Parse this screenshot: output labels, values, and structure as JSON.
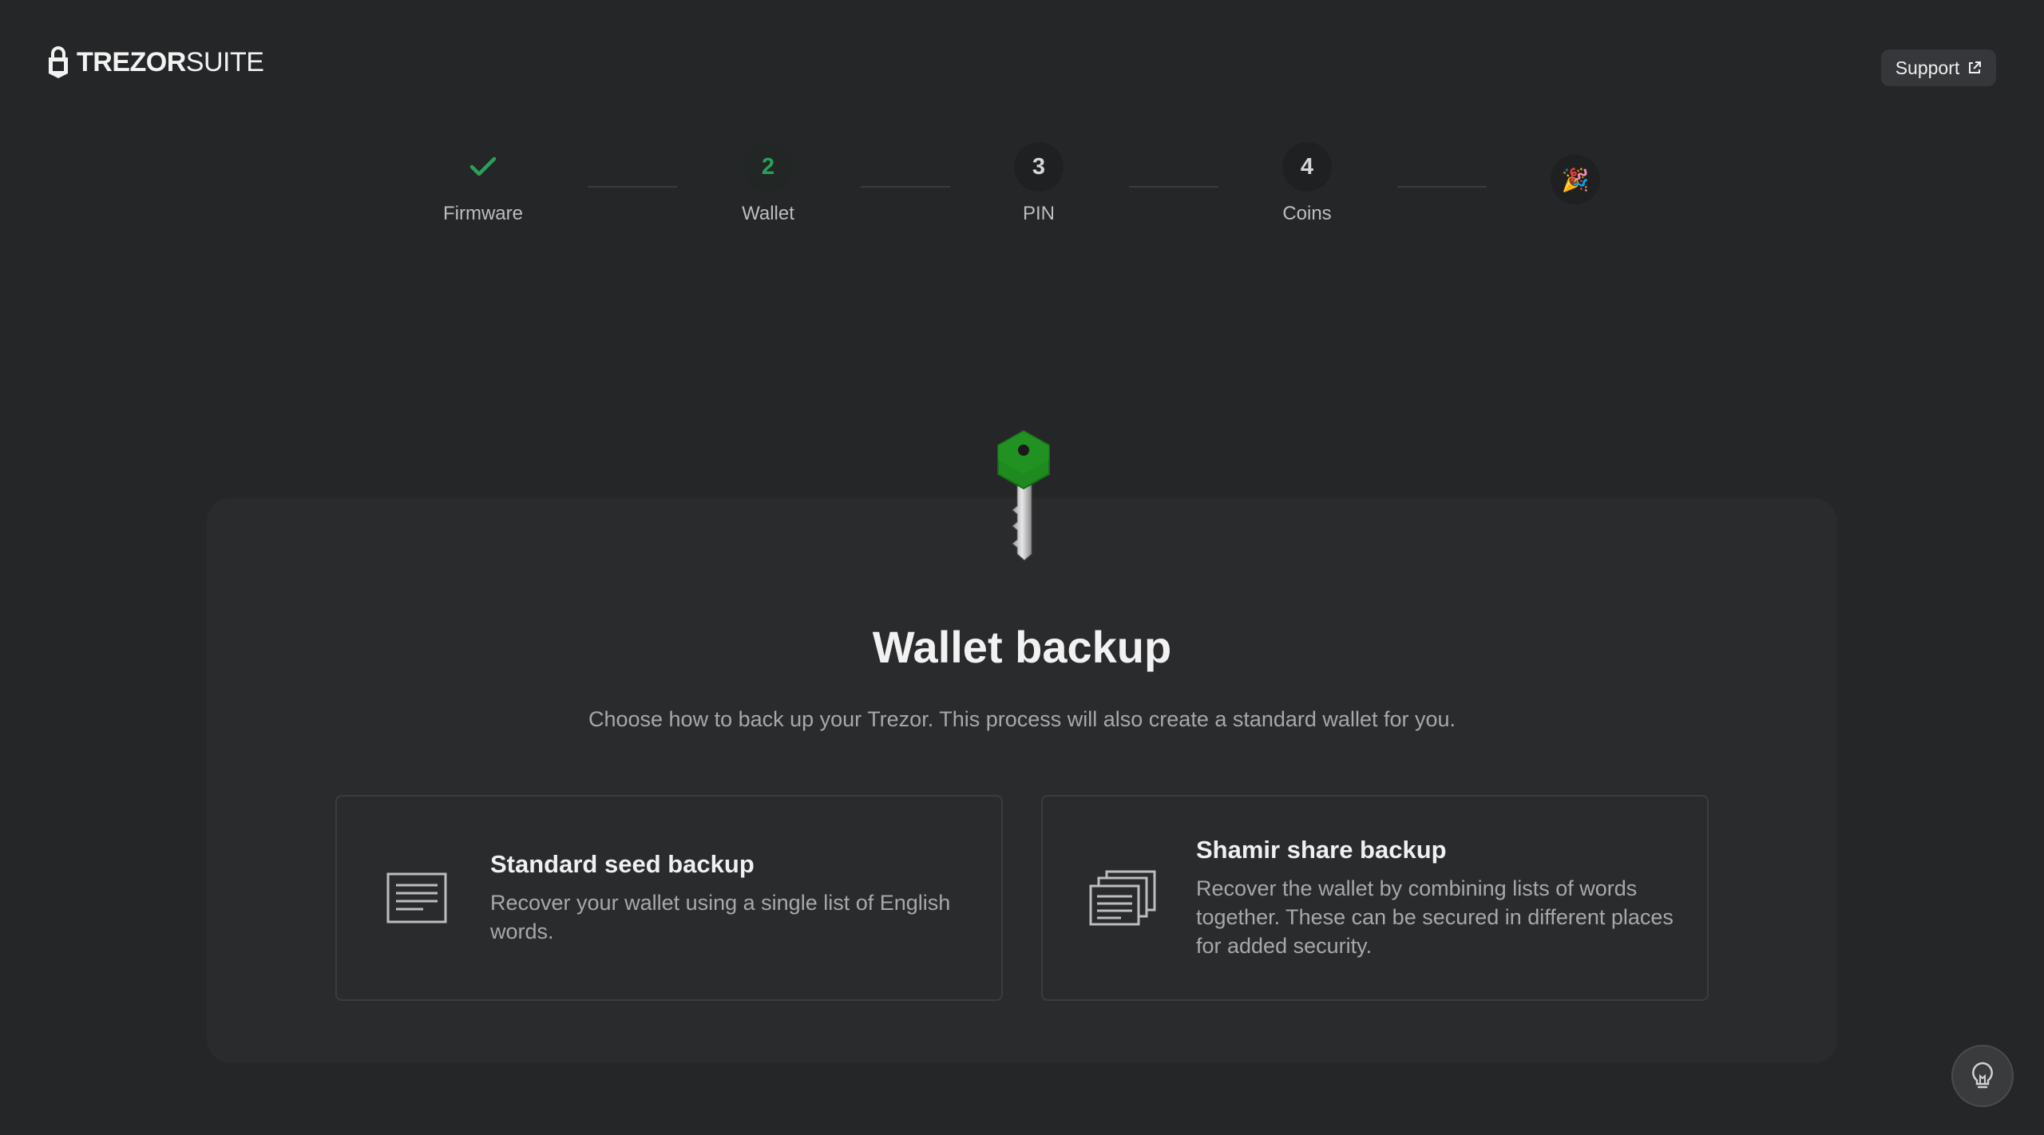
{
  "header": {
    "logo_bold": "TREZOR",
    "logo_light": "SUITE",
    "support_label": "Support"
  },
  "stepper": {
    "steps": [
      {
        "label": "Firmware",
        "number": "",
        "state": "done"
      },
      {
        "label": "Wallet",
        "number": "2",
        "state": "active"
      },
      {
        "label": "PIN",
        "number": "3",
        "state": "pending"
      },
      {
        "label": "Coins",
        "number": "4",
        "state": "pending"
      },
      {
        "label": "",
        "number": "🎉",
        "state": "final"
      }
    ]
  },
  "main": {
    "title": "Wallet backup",
    "subtitle": "Choose how to back up your Trezor. This process will also create a standard wallet for you.",
    "options": [
      {
        "title": "Standard seed backup",
        "description": "Recover your wallet using a single list of English words.",
        "icon": "document-icon"
      },
      {
        "title": "Shamir share backup",
        "description": "Recover the wallet by combining lists of words together. These can be secured in different places for added security.",
        "icon": "stacked-documents-icon"
      }
    ]
  },
  "colors": {
    "accent": "#2aa15a",
    "background": "#252627",
    "card": "#2a2b2d",
    "key_head": "#1f8a1f"
  }
}
